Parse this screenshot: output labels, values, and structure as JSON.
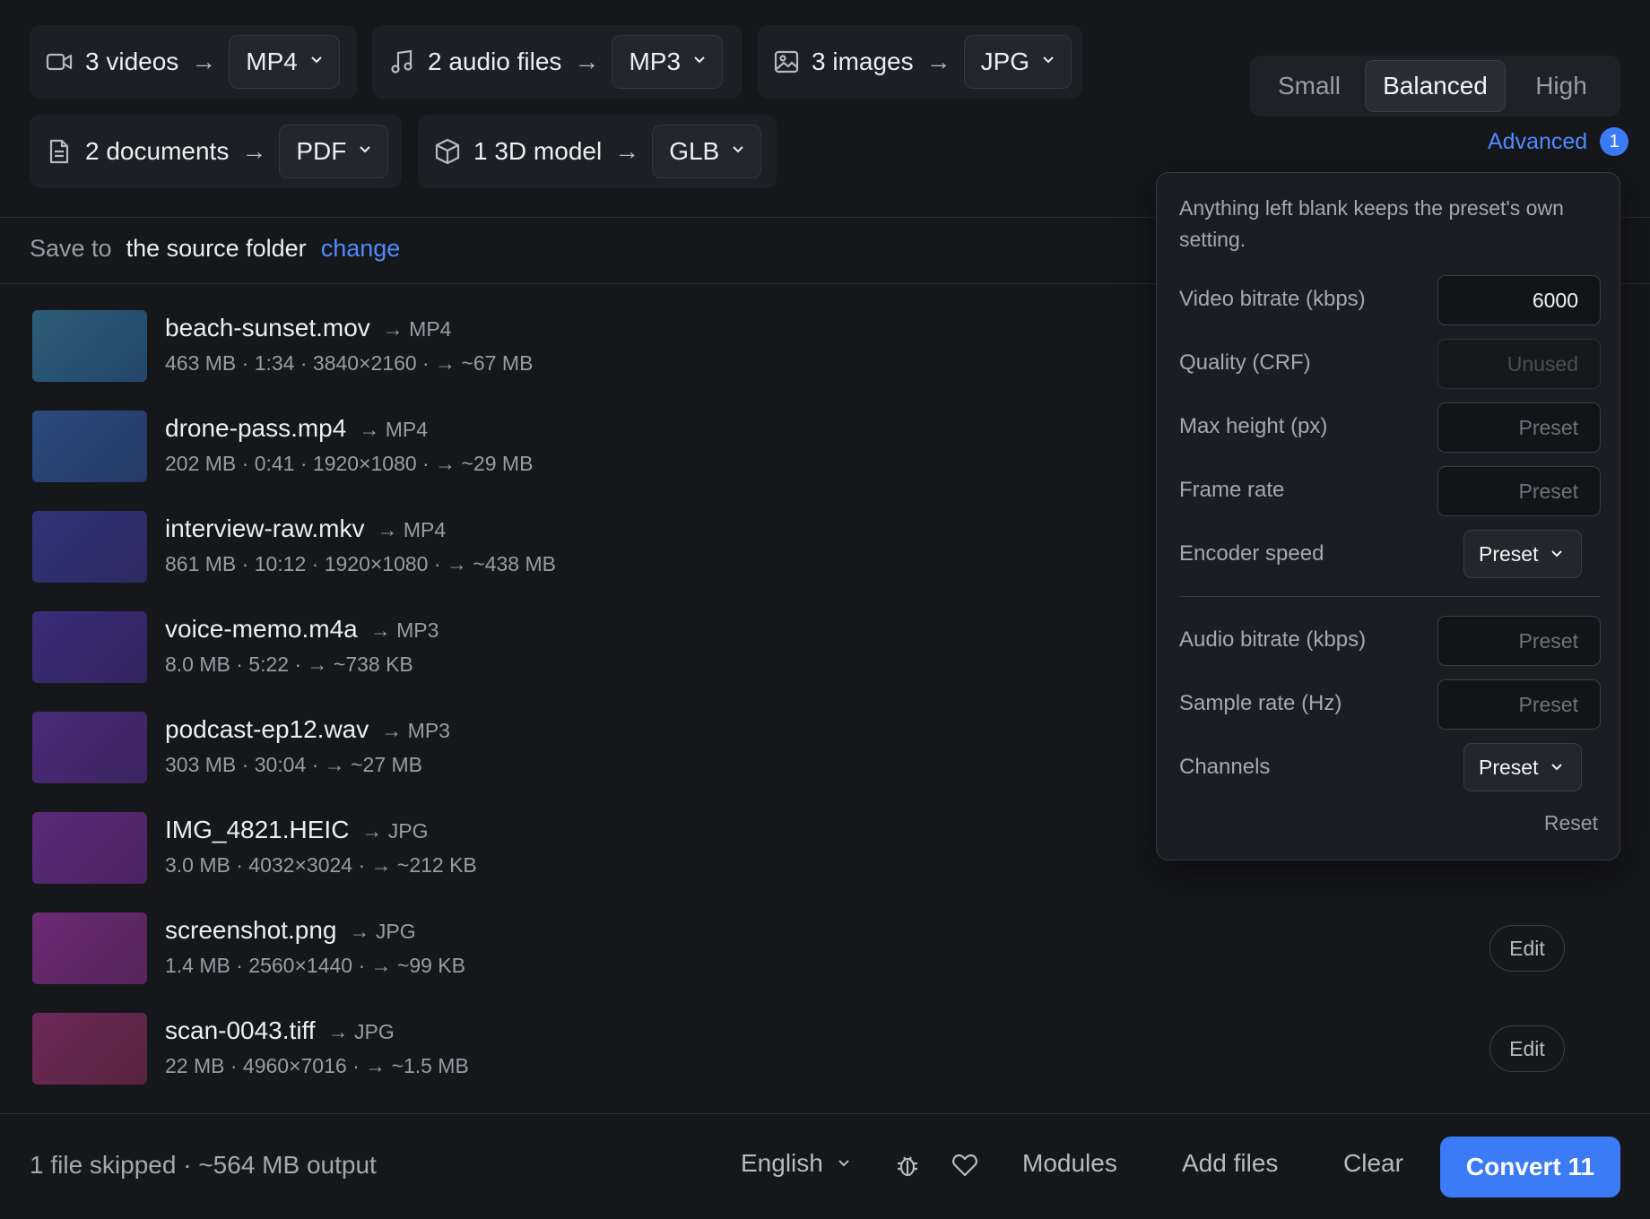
{
  "groups": [
    {
      "icon": "video-camera-icon",
      "label": "3 videos",
      "format": "MP4"
    },
    {
      "icon": "music-note-icon",
      "label": "2 audio files",
      "format": "MP3"
    },
    {
      "icon": "image-icon",
      "label": "3 images",
      "format": "JPG"
    },
    {
      "icon": "document-icon",
      "label": "2 documents",
      "format": "PDF"
    },
    {
      "icon": "cube-icon",
      "label": "1 3D model",
      "format": "GLB"
    }
  ],
  "arrow": "→",
  "quality": {
    "options": [
      "Small",
      "Balanced",
      "High"
    ],
    "selected": "Balanced"
  },
  "advanced": {
    "label": "Advanced",
    "badge": "1"
  },
  "save": {
    "prefix": "Save to",
    "location": "the source folder",
    "change": "change"
  },
  "files": [
    {
      "name": "beach-sunset.mov",
      "target": "→ MP4",
      "meta": "463 MB · 1:34 · 3840×2160 · → ~67 MB",
      "thumb": [
        "#2c5d78",
        "#23466a"
      ]
    },
    {
      "name": "drone-pass.mp4",
      "target": "→ MP4",
      "meta": "202 MB · 0:41 · 1920×1080 · → ~29 MB",
      "thumb": [
        "#2a4a7c",
        "#263a68"
      ]
    },
    {
      "name": "interview-raw.mkv",
      "target": "→ MP4",
      "meta": "861 MB · 10:12 · 1920×1080 · → ~438 MB",
      "thumb": [
        "#2f3577",
        "#2d2a62"
      ]
    },
    {
      "name": "voice-memo.m4a",
      "target": "→ MP3",
      "meta": "8.0 MB · 5:22 · → ~738 KB",
      "thumb": [
        "#3a2c78",
        "#33255f"
      ]
    },
    {
      "name": "podcast-ep12.wav",
      "target": "→ MP3",
      "meta": "303 MB · 30:04 · → ~27 MB",
      "thumb": [
        "#4a2a78",
        "#3d2460"
      ]
    },
    {
      "name": "IMG_4821.HEIC",
      "target": "→ JPG",
      "meta": "3.0 MB · 4032×3024 · → ~212 KB",
      "thumb": [
        "#5a2a7a",
        "#4a2460"
      ]
    },
    {
      "name": "screenshot.png",
      "target": "→ JPG",
      "meta": "1.4 MB · 2560×1440 · → ~99 KB",
      "thumb": [
        "#6b2a74",
        "#55255a"
      ]
    },
    {
      "name": "scan-0043.tiff",
      "target": "→ JPG",
      "meta": "22 MB · 4960×7016 · → ~1.5 MB",
      "thumb": [
        "#6e2a58",
        "#572340"
      ]
    }
  ],
  "edit_label": "Edit",
  "popover": {
    "hint": "Anything left blank keeps the preset's own setting.",
    "video_bitrate": {
      "label": "Video bitrate (kbps)",
      "value": "6000"
    },
    "quality_crf": {
      "label": "Quality (CRF)",
      "placeholder": "Unused"
    },
    "max_height": {
      "label": "Max height (px)",
      "placeholder": "Preset"
    },
    "frame_rate": {
      "label": "Frame rate",
      "placeholder": "Preset"
    },
    "encoder_speed": {
      "label": "Encoder speed",
      "value": "Preset"
    },
    "audio_bitrate": {
      "label": "Audio bitrate (kbps)",
      "placeholder": "Preset"
    },
    "sample_rate": {
      "label": "Sample rate (Hz)",
      "placeholder": "Preset"
    },
    "channels": {
      "label": "Channels",
      "value": "Preset"
    },
    "reset": "Reset"
  },
  "footer": {
    "status": "1 file skipped · ~564 MB output",
    "language": "English",
    "modules": "Modules",
    "add_files": "Add files",
    "clear": "Clear",
    "convert": "Convert 11"
  },
  "colors": {
    "accent": "#3b7bf5",
    "link": "#4f8bff",
    "background": "#16171b"
  }
}
